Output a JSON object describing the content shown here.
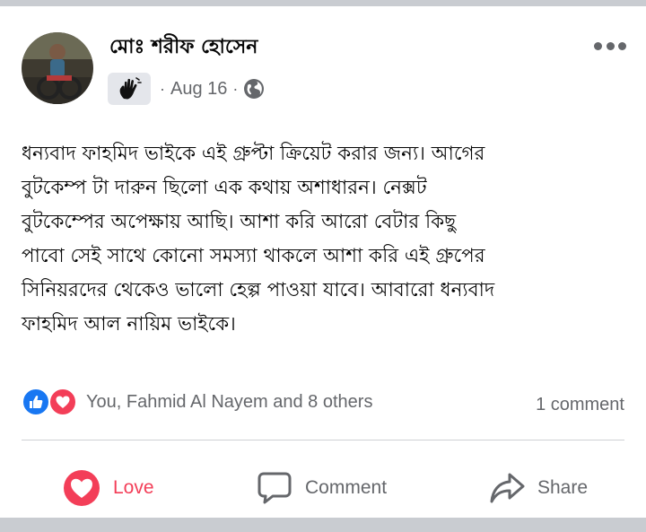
{
  "post": {
    "author": "মোঃ শরীফ হোসেন",
    "date": "Aug 16",
    "separator": "·",
    "text": "ধন্যবাদ ফাহমিদ ভাইকে এই গ্রুপ্টা ক্রিয়েট করার জন্য। আগের\nবুটকেম্প টা দারুন ছিলো এক কথায় অশাধারন। নেক্সট\nবুটকেম্পের অপেক্ষায় আছি। আশা করি আরো বেটার কিছু\nপাবো সেই সাথে কোনো সমস্যা থাকলে আশা করি এই গ্রুপের\nসিনিয়রদের থেকেও ভালো হেল্প পাওয়া যাবে। আবারো ধন্যবাদ\nফাহমিদ আল নায়িম ভাইকে।",
    "badge_icon": "hand-wave-icon",
    "privacy_icon": "globe-icon"
  },
  "reactions": {
    "summary": "You, Fahmid Al Nayem and 8 others",
    "icons": [
      "like-icon",
      "love-icon"
    ],
    "comments": "1 comment"
  },
  "actions": {
    "love": "Love",
    "comment": "Comment",
    "share": "Share"
  },
  "colors": {
    "love": "#f33e58",
    "like": "#1877f2",
    "secondary_text": "#65676b",
    "background": "#c9ccd1"
  }
}
